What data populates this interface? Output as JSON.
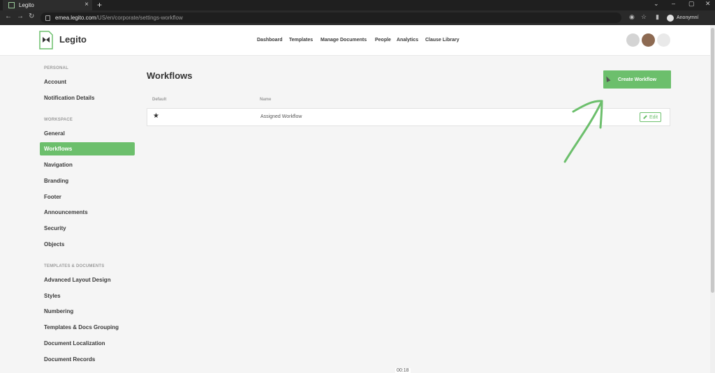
{
  "browser": {
    "tab_title": "Legito",
    "url_domain": "emea.legito.com",
    "url_path": "/US/en/corporate/settings-workflow",
    "profile_label": "Anonymní"
  },
  "app": {
    "brand": "Legito"
  },
  "topnav": [
    "Dashboard",
    "Templates",
    "Manage Documents",
    "People",
    "Analytics",
    "Clause Library"
  ],
  "sidebar": {
    "personal_heading": "PERSONAL",
    "personal": [
      "Account",
      "Notification Details"
    ],
    "workspace_heading": "WORKSPACE",
    "workspace": [
      "General",
      "Workflows",
      "Navigation",
      "Branding",
      "Footer",
      "Announcements",
      "Security",
      "Objects"
    ],
    "templates_heading": "TEMPLATES & DOCUMENTS",
    "templates": [
      "Advanced Layout Design",
      "Styles",
      "Numbering",
      "Templates & Docs Grouping",
      "Document Localization",
      "Document Records"
    ],
    "active": "Workflows"
  },
  "main": {
    "title": "Workflows",
    "create_label": "Create Workflow",
    "col_default": "Default",
    "col_name": "Name",
    "rows": [
      {
        "name": "Assigned Workflow",
        "default": true,
        "edit_label": "Edit"
      }
    ]
  },
  "overlay": {
    "timer": "00:18"
  },
  "colors": {
    "accent": "#6cbf6c"
  }
}
